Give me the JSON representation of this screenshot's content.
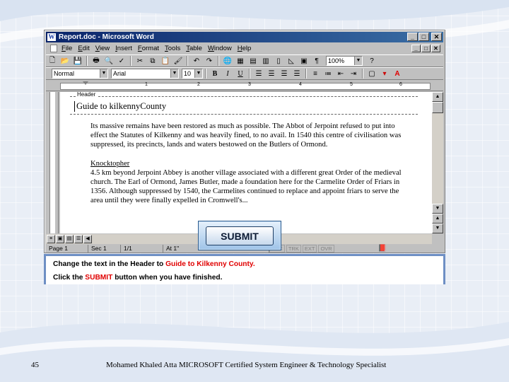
{
  "window": {
    "title": "Report.doc - Microsoft Word"
  },
  "menu": [
    "File",
    "Edit",
    "View",
    "Insert",
    "Format",
    "Tools",
    "Table",
    "Window",
    "Help"
  ],
  "toolbar": {
    "zoom": "100%",
    "style": "Normal",
    "font": "Arial",
    "size": "10",
    "bold": "B",
    "italic": "I",
    "underline": "U"
  },
  "ruler": {
    "numbers": [
      "1",
      "2",
      "3",
      "4",
      "5",
      "6"
    ]
  },
  "document": {
    "header_tag": "Header",
    "header_text": "Guide to kilkennyCounty",
    "paragraph1": "Its massive remains have been restored as much as possible.  The Abbot of Jerpoint refused to put into effect the Statutes of Kilkenny and was heavily fined, to no avail.  In 1540 this centre of civilisation was suppressed, its precincts, lands and waters bestowed on the Butlers of Ormond.",
    "heading2": "Knocktopher",
    "paragraph2": "4.5 km beyond Jerpoint Abbey is another village associated with a different great Order of the medieval church.  The Earl of Ormond, James Butler, made a foundation here for the Carmelite Order of Friars in 1356.  Although suppressed by 1540, the Carmelites continued to replace and appoint friars to serve the area until they were finally expelled in Cromwell's..."
  },
  "status": {
    "page": "Page 1",
    "sec": "Sec 1",
    "pages": "1/1",
    "at": "At 1\"",
    "rec": "REC",
    "trk": "TRK",
    "ext": "EXT",
    "ovr": "OVR"
  },
  "submit": {
    "label": "SUBMIT"
  },
  "instructions": {
    "line1_prefix": "Change the text in the Header to ",
    "line1_highlight": "Guide to Kilkenny County.",
    "line2_prefix": "Click the ",
    "line2_highlight": "SUBMIT",
    "line2_suffix": " button when you have finished."
  },
  "footer": {
    "slide_number": "45",
    "credit": "Mohamed Khaled Atta MICROSOFT Certified System Engineer & Technology Specialist"
  },
  "colors": {
    "title_bar": "#0a246a",
    "highlight_text": "#e00000",
    "instruction_border": "#6e8fc4",
    "slide_background": "#e9eef6"
  }
}
